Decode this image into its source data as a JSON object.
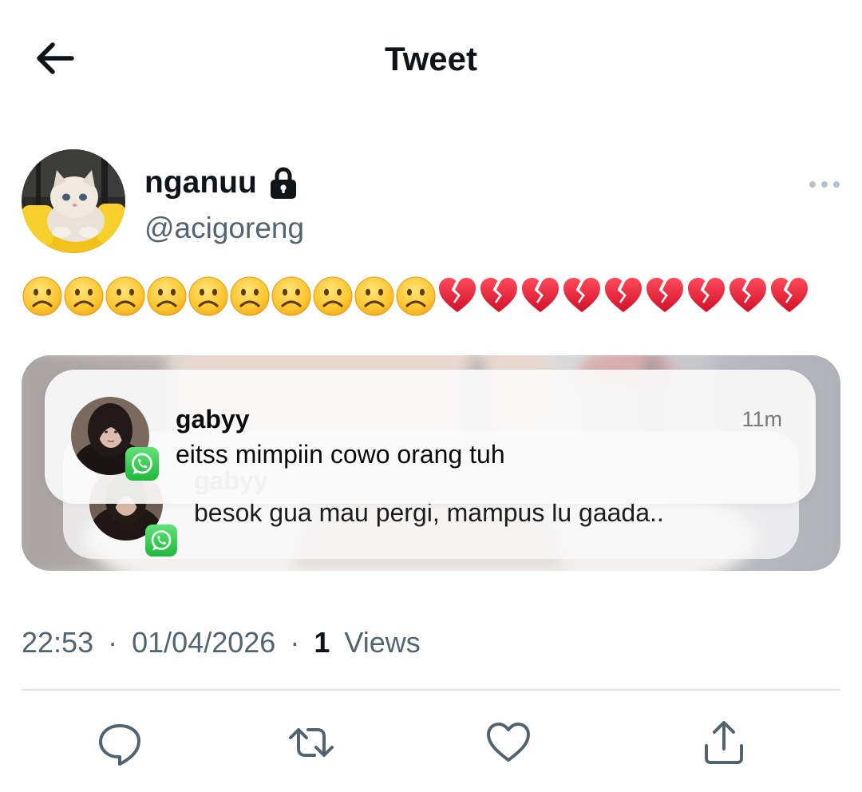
{
  "header": {
    "title": "Tweet"
  },
  "author": {
    "display_name": "nganuu",
    "handle": "@acigoreng",
    "protected": true
  },
  "tweet": {
    "emojis": [
      "frowning-face",
      "frowning-face",
      "frowning-face",
      "frowning-face",
      "frowning-face",
      "frowning-face",
      "frowning-face",
      "frowning-face",
      "frowning-face",
      "frowning-face",
      "broken-heart",
      "broken-heart",
      "broken-heart",
      "broken-heart",
      "broken-heart",
      "broken-heart",
      "broken-heart",
      "broken-heart",
      "broken-heart"
    ]
  },
  "media": {
    "notifications": [
      {
        "sender": "gabyy",
        "message": "eitss mimpiin cowo orang tuh",
        "time": "11m",
        "app_icon": "whatsapp-icon"
      },
      {
        "sender": "gabyy",
        "message": "besok gua mau pergi, mampus lu gaada..",
        "app_icon": "whatsapp-icon"
      }
    ]
  },
  "meta": {
    "time": "22:53",
    "separator": "·",
    "date": "01/04/2026",
    "views_count": "1",
    "views_label": "Views"
  },
  "actions": [
    "reply-icon",
    "retweet-icon",
    "like-icon",
    "share-icon"
  ],
  "colors": {
    "secondary_text": "#536471",
    "primary_text": "#0f1419",
    "whatsapp": "#25d366",
    "divider": "#dfe4e8"
  }
}
